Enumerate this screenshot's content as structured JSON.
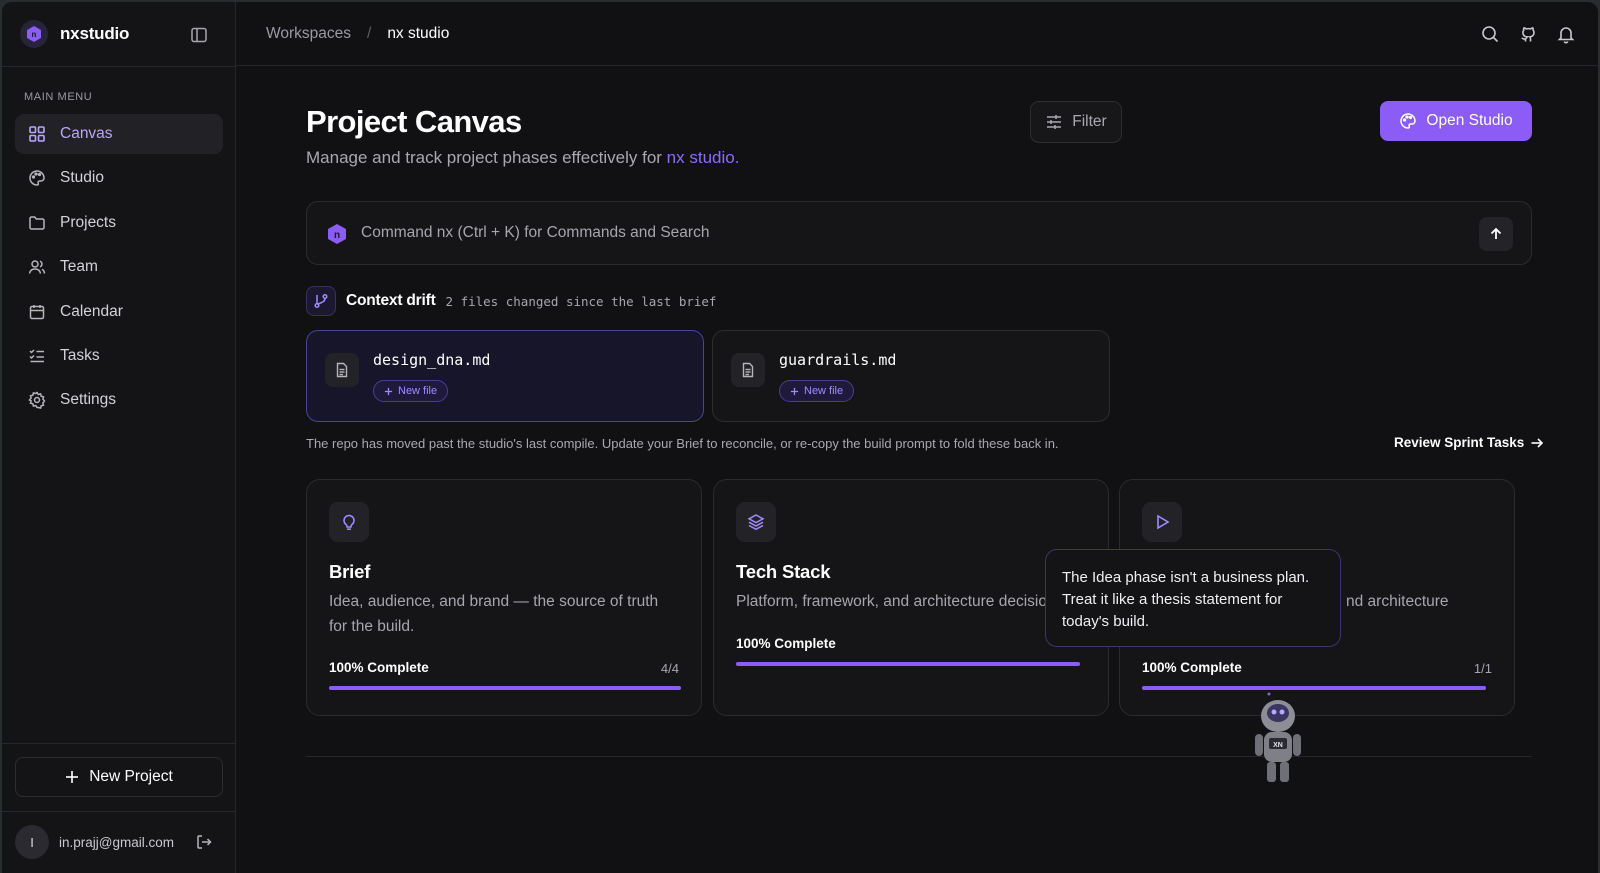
{
  "app": {
    "name": "nxstudio"
  },
  "colors": {
    "accent": "#8b5cf6",
    "accent_text": "#8b6cff",
    "background": "#111113"
  },
  "sidebar": {
    "menu_title": "MAIN MENU",
    "items": [
      {
        "label": "Canvas",
        "icon": "grid-icon",
        "active": true
      },
      {
        "label": "Studio",
        "icon": "palette-icon"
      },
      {
        "label": "Projects",
        "icon": "folder-icon"
      },
      {
        "label": "Team",
        "icon": "users-icon"
      },
      {
        "label": "Calendar",
        "icon": "calendar-icon"
      },
      {
        "label": "Tasks",
        "icon": "list-checks-icon"
      },
      {
        "label": "Settings",
        "icon": "gear-icon"
      }
    ],
    "new_project_label": "New Project",
    "user": {
      "initial": "I",
      "email": "in.prajj@gmail.com"
    }
  },
  "topbar": {
    "breadcrumbs": [
      "Workspaces",
      "/",
      "nx studio"
    ],
    "icons": [
      "search-icon",
      "github-icon",
      "bell-icon"
    ]
  },
  "main": {
    "title": "Project Canvas",
    "subtitle_prefix": "Manage and track project phases effectively for ",
    "subtitle_accent": "nx studio.",
    "filter_label": "Filter",
    "open_studio_label": "Open Studio",
    "command_placeholder": "Command nx (Ctrl + K) for Commands and Search",
    "context_drift": {
      "title": "Context drift",
      "subtitle": "2 files changed since the last brief",
      "files": [
        {
          "name": "design_dna.md",
          "badge": "New file"
        },
        {
          "name": "guardrails.md",
          "badge": "New file"
        }
      ]
    },
    "repo_note": "The repo has moved past the studio's last compile. Update your Brief to reconcile, or re-copy the build prompt to fold these back in.",
    "review_link": "Review Sprint Tasks",
    "phases": [
      {
        "title": "Brief",
        "icon": "lightbulb-icon",
        "desc": "Idea, audience, and brand — the source of truth for the build.",
        "progress_label": "100% Complete",
        "count": "4/4",
        "progress": 1.0
      },
      {
        "title": "Tech Stack",
        "icon": "layers-icon",
        "desc": "Platform, framework, and architecture decisions",
        "progress_label": "100% Complete",
        "count": "",
        "progress": 1.0
      },
      {
        "title": "",
        "icon": "play-icon",
        "desc": "nd architecture",
        "progress_label": "100% Complete",
        "count": "1/1",
        "progress": 1.0
      }
    ],
    "tooltip": "The Idea phase isn't a business plan. Treat it like a thesis statement for today's build.",
    "mascot_badge": "XN"
  }
}
